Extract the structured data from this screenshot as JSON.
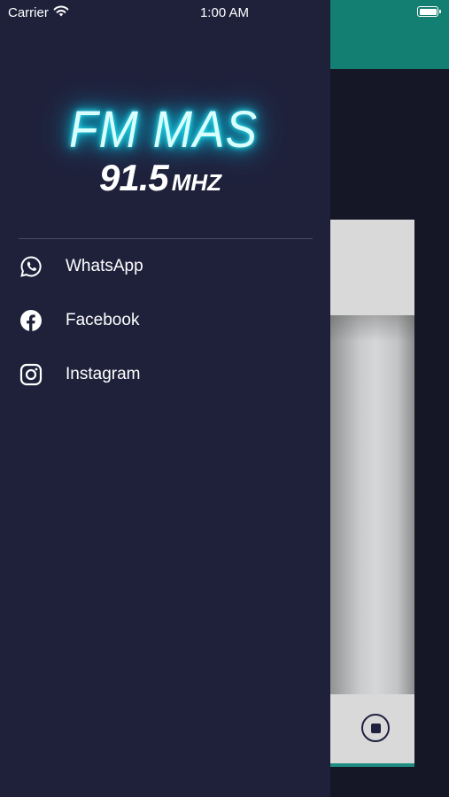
{
  "status_bar": {
    "carrier": "Carrier",
    "time": "1:00 AM"
  },
  "logo": {
    "line1": "FM MAS",
    "frequency": "91.5",
    "unit": "MHZ"
  },
  "menu": {
    "items": [
      {
        "label": "WhatsApp",
        "icon": "whatsapp-icon"
      },
      {
        "label": "Facebook",
        "icon": "facebook-icon"
      },
      {
        "label": "Instagram",
        "icon": "instagram-icon"
      }
    ]
  },
  "colors": {
    "drawer_bg": "#1f213b",
    "header_teal": "#137e72",
    "logo_glow": "#10d8f0"
  }
}
